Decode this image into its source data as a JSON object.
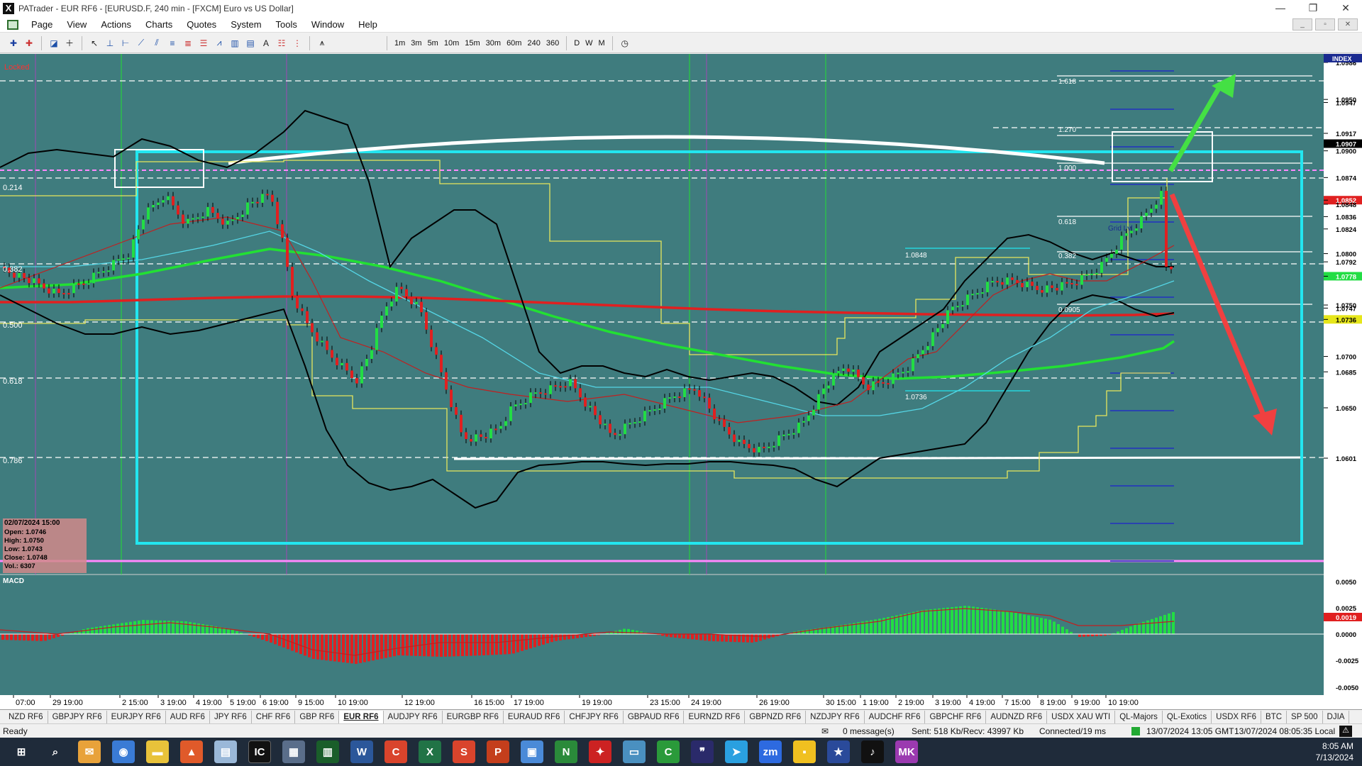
{
  "window": {
    "title": "PATrader - EUR RF6 - [EURUSD.F, 240 min - [FXCM] Euro vs US Dollar]",
    "app_icon": "X"
  },
  "menu": [
    "Page",
    "View",
    "Actions",
    "Charts",
    "Quotes",
    "System",
    "Tools",
    "Window",
    "Help"
  ],
  "timeframes": [
    "1m",
    "3m",
    "5m",
    "10m",
    "15m",
    "30m",
    "60m",
    "240",
    "360",
    "D",
    "W",
    "M"
  ],
  "chart": {
    "locked_label": "Locked",
    "index_label": "INDEX",
    "left_levels": [
      "0.214",
      "0.382",
      "0.500",
      "0.618",
      "0.786"
    ],
    "fib_labels": [
      "1.618",
      "1.270",
      "1.000",
      "0.618",
      "0.382",
      "0.0905"
    ],
    "price_labels_chart": [
      "1.0848",
      "1.0736"
    ],
    "grid_label": "Grid Lvl",
    "price_scale": [
      "1.0986",
      "1.0950",
      "1.0947",
      "1.0917",
      "1.0907",
      "1.0900",
      "1.0874",
      "1.0852",
      "1.0848",
      "1.0836",
      "1.0824",
      "1.0800",
      "1.0792",
      "1.0778",
      "1.0750",
      "1.0747",
      "1.0736",
      "1.0700",
      "1.0685",
      "1.0650",
      "1.0601"
    ],
    "info_box": {
      "date": "02/07/2024 15:00",
      "open": "Open: 1.0746",
      "high": "High: 1.0750",
      "low": "Low: 1.0743",
      "close": "Close: 1.0748",
      "vol": "Vol.: 6307"
    },
    "macd_label": "MACD",
    "macd_scale": [
      "0.0050",
      "0.0025",
      "0.0019",
      "0.0000",
      "-0.0025",
      "-0.0050"
    ],
    "time_axis": [
      "07:00",
      "29 19:00",
      "2 15:00",
      "3 19:00",
      "4 19:00",
      "5 19:00",
      "6 19:00",
      "9 15:00",
      "10 19:00",
      "12 19:00",
      "16 15:00",
      "17 19:00",
      "19 19:00",
      "23 15:00",
      "24 19:00",
      "26 19:00",
      "30 15:00",
      "1 19:00",
      "2 19:00",
      "3 19:00",
      "4 19:00",
      "7 15:00",
      "8 19:00",
      "9 19:00",
      "10 19:00"
    ],
    "colors": {
      "background": "#3f7c7e",
      "bull": "#22dd44",
      "bear": "#e02020",
      "box": "#22e6f0",
      "ma_green": "#22e033",
      "ma_red": "#e02020"
    }
  },
  "symbol_tabs": [
    "NZD RF6",
    "GBPJPY RF6",
    "EURJPY RF6",
    "AUD RF6",
    "JPY RF6",
    "CHF RF6",
    "GBP RF6",
    "EUR RF6",
    "AUDJPY RF6",
    "EURGBP RF6",
    "EURAUD RF6",
    "CHFJPY RF6",
    "GBPAUD RF6",
    "EURNZD RF6",
    "GBPNZD RF6",
    "NZDJPY RF6",
    "AUDCHF RF6",
    "GBPCHF RF6",
    "AUDNZD RF6",
    "USDX XAU WTI",
    "QL-Majors",
    "QL-Exotics",
    "USDX RF6",
    "BTC",
    "SP 500",
    "DJIA"
  ],
  "active_tab": "EUR RF6",
  "status": {
    "ready": "Ready",
    "messages": "0 message(s)",
    "traffic": "Sent: 518 Kb/Recv: 43997 Kb",
    "connection": "Connected/19 ms",
    "gmt": "13/07/2024 13:05 GMT",
    "local": "13/07/2024 08:05:35 Local"
  },
  "taskbar": {
    "time": "8:05 AM",
    "date": "7/13/2024",
    "apps": [
      "start-icon",
      "search-icon",
      "mail-icon",
      "chrome-icon",
      "folder-icon",
      "brave-icon",
      "notes-icon",
      "ic-icon",
      "calculator-icon",
      "chart-app-icon",
      "word-icon",
      "c-app-icon",
      "excel-icon",
      "s-app-icon",
      "powerpoint-icon",
      "photos-icon",
      "n-app-icon",
      "bird-icon",
      "remote-icon",
      "camtasia-icon",
      "quotes-icon",
      "telegram-icon",
      "zoom-icon",
      "sticky-icon",
      "star-icon",
      "tiktok-icon",
      "mk-icon"
    ],
    "app_glyphs": [
      "⊞",
      "⌕",
      "✉",
      "◉",
      "▬",
      "▲",
      "▤",
      "IC",
      "▦",
      "▥",
      "W",
      "C",
      "X",
      "S",
      "P",
      "▣",
      "N",
      "✦",
      "▭",
      "C",
      "❞",
      "➤",
      "zm",
      "▪",
      "★",
      "♪",
      "MK"
    ]
  }
}
